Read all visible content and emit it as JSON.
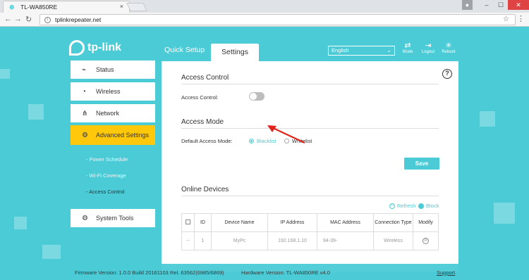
{
  "browser": {
    "tab_title": "TL-WA850RE",
    "tab_close": "×",
    "url": "tplinkrepeater.net",
    "window_controls": {
      "minimize": "‒",
      "maximize": "☐",
      "close": "✕"
    }
  },
  "header": {
    "logo_text": "tp-link",
    "tabs": [
      {
        "label": "Quick Setup"
      },
      {
        "label": "Settings"
      }
    ],
    "language": "English",
    "icons": [
      {
        "label": "Mode"
      },
      {
        "label": "Logout"
      },
      {
        "label": "Reboot"
      }
    ]
  },
  "sidebar": {
    "items": [
      {
        "label": "Status",
        "icon": "pulse-icon"
      },
      {
        "label": "Wireless",
        "icon": "wifi-icon"
      },
      {
        "label": "Network",
        "icon": "network-icon"
      },
      {
        "label": "Advanced Settings",
        "icon": "advanced-settings-icon"
      },
      {
        "label": "System Tools",
        "icon": "gear-icon"
      }
    ],
    "subitems": [
      {
        "label": "- Power Schedule"
      },
      {
        "label": "- Wi-Fi Coverage"
      },
      {
        "label": "- Access Control"
      }
    ]
  },
  "main": {
    "access_control": {
      "heading": "Access Control",
      "toggle_label": "Access Control:",
      "enabled": false
    },
    "access_mode": {
      "heading": "Access Mode",
      "label": "Default Access Mode:",
      "options": [
        {
          "label": "Blacklist",
          "selected": true
        },
        {
          "label": "Whitelist",
          "selected": false
        }
      ],
      "save_label": "Save"
    },
    "online_devices": {
      "heading": "Online Devices",
      "refresh_label": "Refresh",
      "block_label": "Block",
      "columns": [
        "",
        "ID",
        "Device Name",
        "IP Address",
        "MAC Address",
        "Connection Type",
        "Modify"
      ],
      "rows": [
        {
          "check": "--",
          "id": "1",
          "name": "MyPc",
          "ip": "192.168.1.10",
          "mac": "94-39-",
          "type": "Wireless"
        }
      ]
    }
  },
  "footer": {
    "firmware": "Firmware Version: 1.0.0 Build 20161103 Rel. 63562(6985/6869)",
    "hardware": "Hardware Version: TL-WA850RE v4.0",
    "support": "Support"
  },
  "colors": {
    "accent": "#4acbd6",
    "active": "#ffc80a",
    "annotation_arrow": "#e0241c"
  }
}
